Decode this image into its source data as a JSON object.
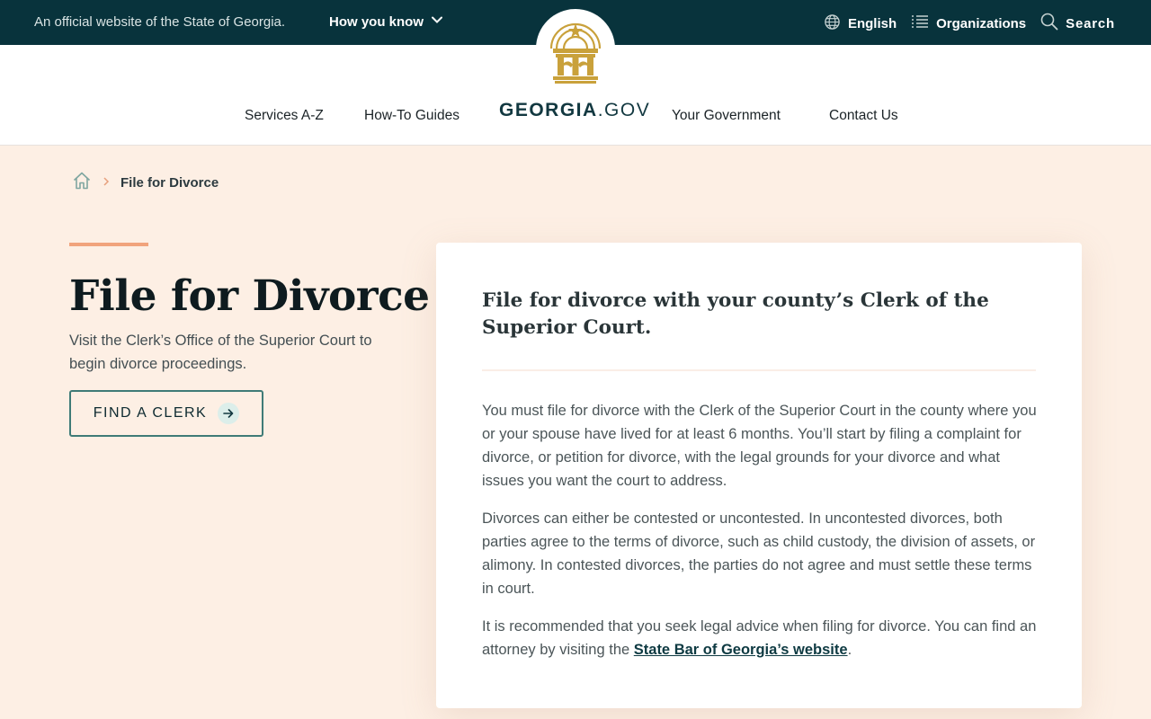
{
  "topbar": {
    "official_text": "An official website of the State of Georgia.",
    "how_you_know": "How you know",
    "language": "English",
    "organizations": "Organizations",
    "search": "Search"
  },
  "header": {
    "brand_bold": "GEORGIA",
    "brand_suffix": ".GOV",
    "nav": {
      "services": "Services A-Z",
      "guides": "How-To Guides",
      "government": "Your Government",
      "contact": "Contact Us"
    }
  },
  "breadcrumb": {
    "current": "File for Divorce"
  },
  "hero": {
    "title": "File for Divorce",
    "lede": "Visit the Clerk’s Office of the Superior Court to begin divorce proceedings.",
    "button_label": "FIND A CLERK"
  },
  "card": {
    "heading": "File for divorce with your county’s Clerk of the Superior Court.",
    "p1": "You must file for divorce with the Clerk of the Superior Court in the county where you or your spouse have lived for at least 6 months. You’ll start by filing a complaint for divorce, or petition for divorce, with the legal grounds for your divorce and what issues you want the court to address.",
    "p2": "Divorces can either be contested or uncontested. In uncontested divorces, both parties agree to the terms of divorce, such as child custody, the division of assets, or alimony. In contested divorces, the parties do not agree and must settle these terms in court.",
    "p3_before": "It is recommended that you seek legal advice when filing for divorce. You can find an attorney by visiting the ",
    "p3_link": "State Bar of Georgia’s website",
    "p3_after": "."
  },
  "colors": {
    "topbar_bg": "#08333c",
    "page_bg": "#fdefe4",
    "accent": "#f1a37c",
    "button_border": "#3f7b77",
    "seal_gold": "#c9a13b"
  },
  "icons": [
    "chevron-down-icon",
    "globe-icon",
    "list-icon",
    "search-icon",
    "home-icon",
    "chevron-right-icon",
    "arrow-right-icon",
    "georgia-seal"
  ]
}
